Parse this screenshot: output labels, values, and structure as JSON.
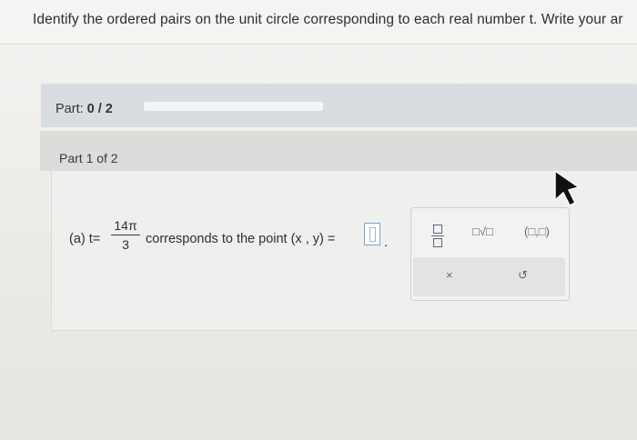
{
  "header": {
    "instruction": "Identify the ordered pairs on the unit circle corresponding to each real number t. Write your ar"
  },
  "part_bar": {
    "label": "Part: ",
    "progress": "0 / 2"
  },
  "part1": {
    "label": "Part 1 of 2"
  },
  "problem": {
    "prefix": "(a) t=",
    "numerator": "14π",
    "denominator": "3",
    "text": "corresponds to the point (x , y) ="
  },
  "palette": {
    "sqrt_label": "□√□",
    "pair_label": "(□,□)",
    "clear_label": "×",
    "undo_label": "↺"
  }
}
